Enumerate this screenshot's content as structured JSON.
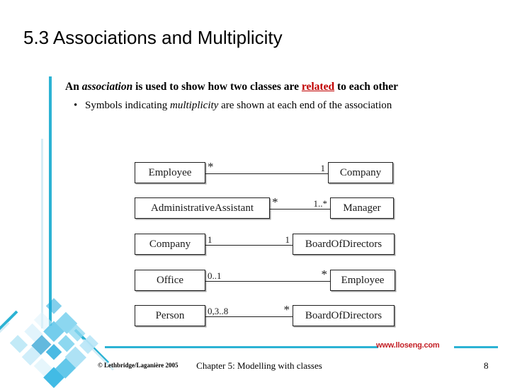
{
  "slide": {
    "title": "5.3 Associations and Multiplicity",
    "lead_prefix": "An ",
    "lead_italic": "association",
    "lead_middle": " is used to show how two classes are ",
    "lead_highlight": "related",
    "lead_suffix": " to each other",
    "bullet_prefix": "Symbols indicating ",
    "bullet_italic": "multiplicity",
    "bullet_suffix": " are shown at each end of the association"
  },
  "colors": {
    "accent": "#2CB3D4",
    "accent_pale": "#D6EDF6",
    "highlight_red": "#C00000",
    "url_red": "#C42026",
    "box_border": "#202020"
  },
  "diagram": {
    "type": "uml-class-association",
    "rows": [
      {
        "left_class": "Employee",
        "left_multiplicity": "*",
        "right_multiplicity": "1",
        "right_class": "Company"
      },
      {
        "left_class": "AdministrativeAssistant",
        "left_multiplicity": "*",
        "right_multiplicity": "1..*",
        "right_class": "Manager"
      },
      {
        "left_class": "Company",
        "left_multiplicity": "1",
        "right_multiplicity": "1",
        "right_class": "BoardOfDirectors"
      },
      {
        "left_class": "Office",
        "left_multiplicity": "0..1",
        "right_multiplicity": "*",
        "right_class": "Employee"
      },
      {
        "left_class": "Person",
        "left_multiplicity": "0,3..8",
        "right_multiplicity": "*",
        "right_class": "BoardOfDirectors"
      }
    ]
  },
  "footer": {
    "url": "www.lloseng.com",
    "copyright": "© Lethbridge/Laganière 2005",
    "chapter": "Chapter 5: Modelling with classes",
    "page": "8"
  }
}
